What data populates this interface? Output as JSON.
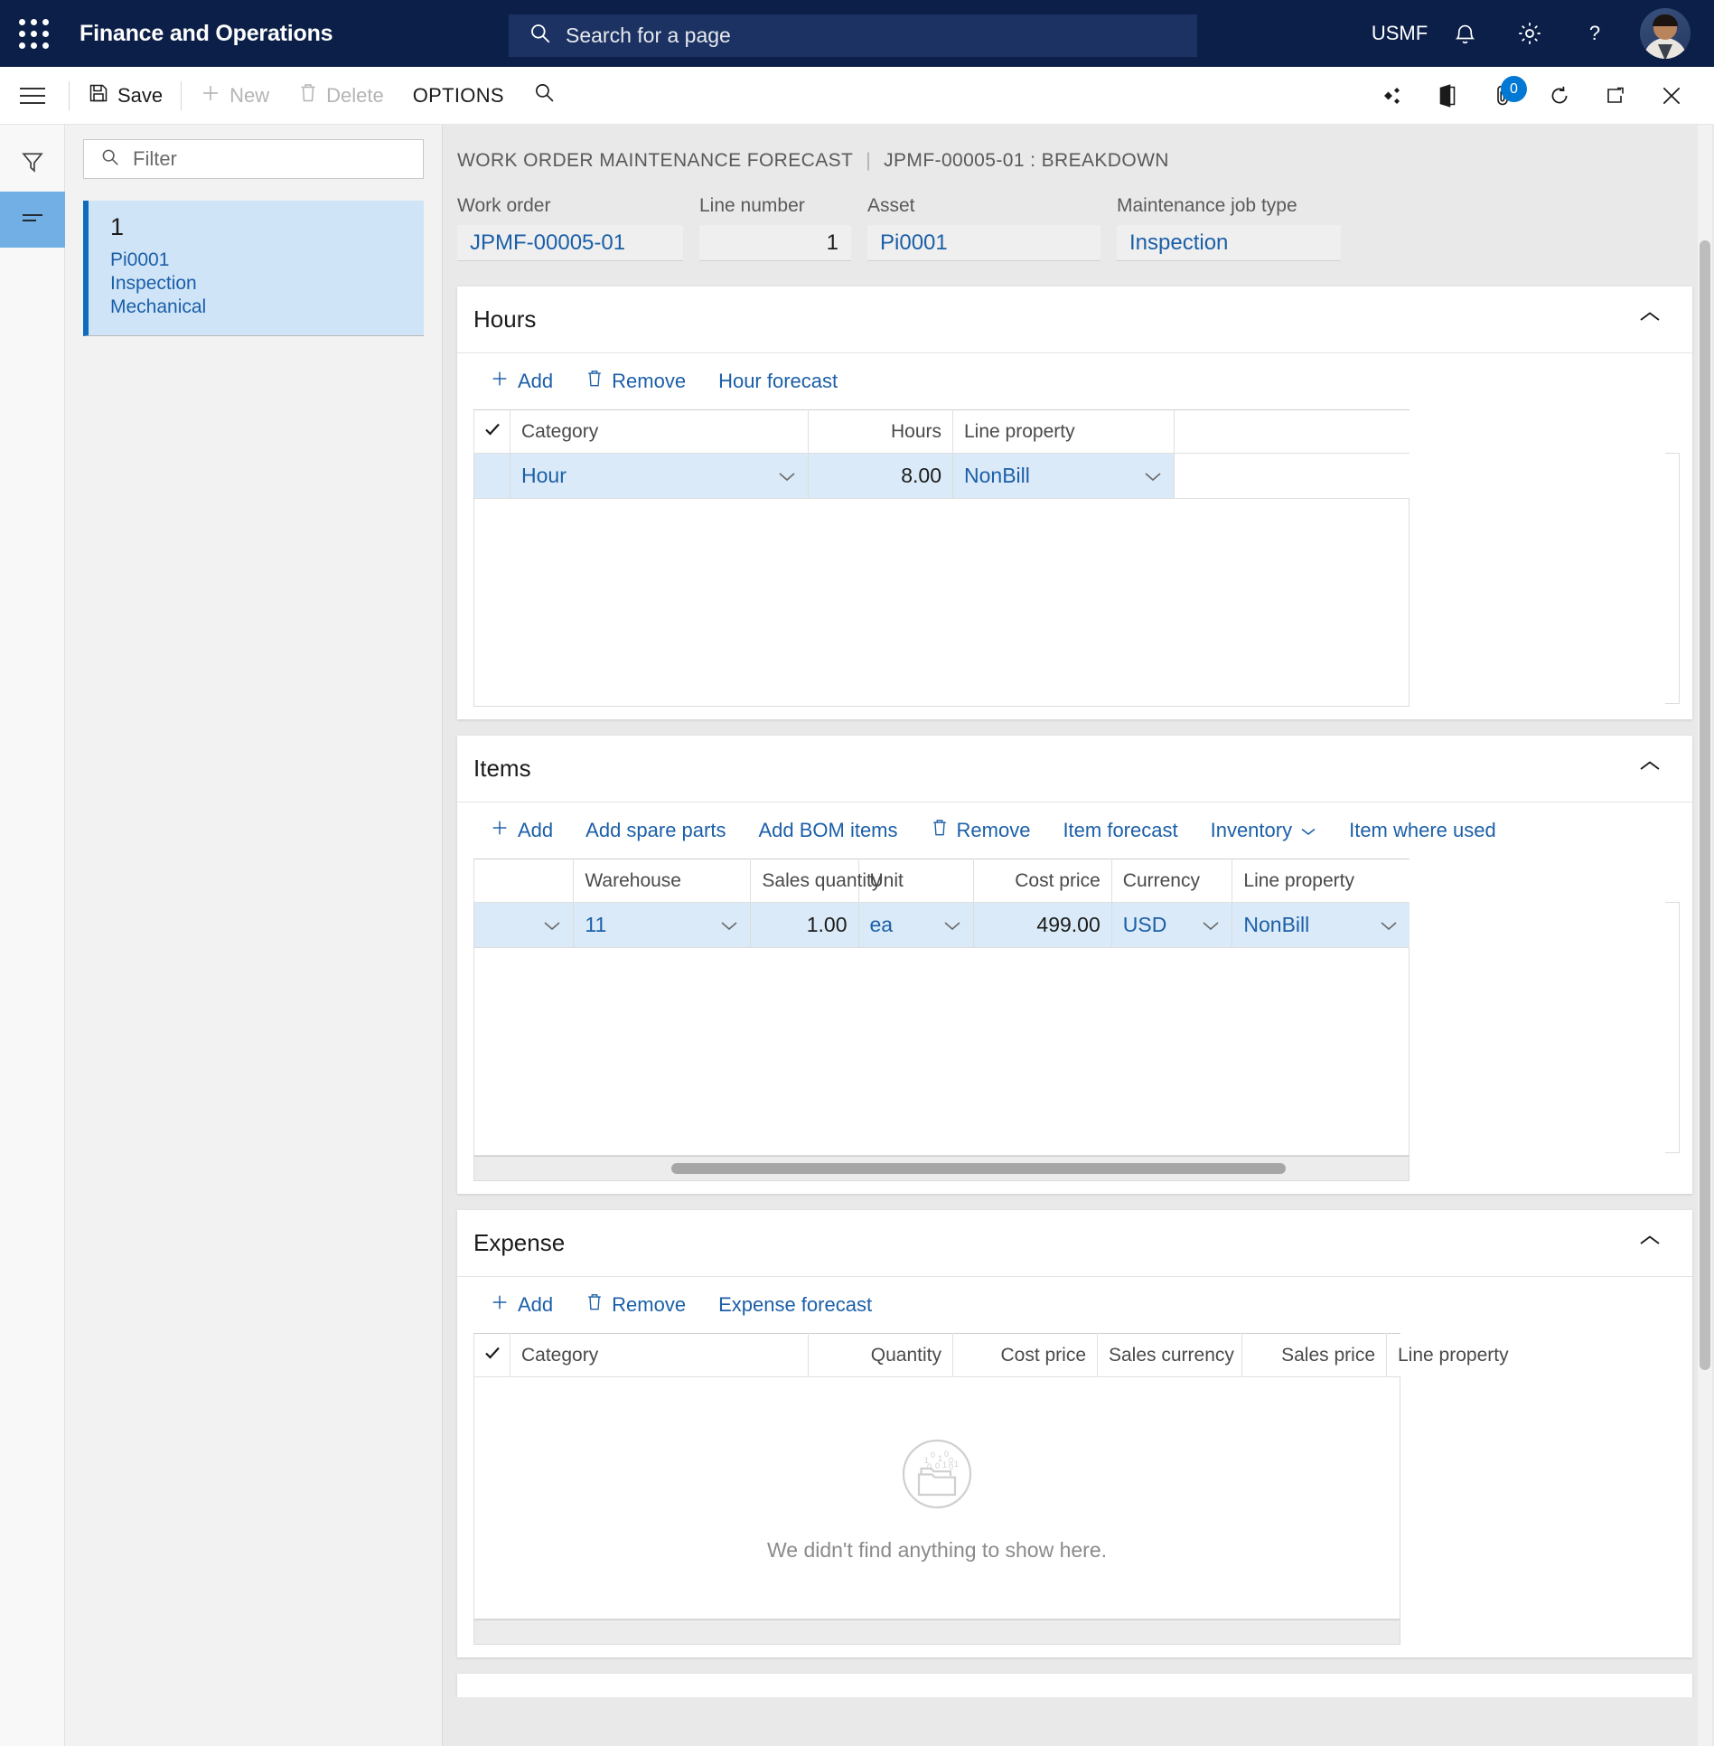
{
  "topnav": {
    "waffle_label": "app-launcher",
    "app_title": "Finance and Operations",
    "search_placeholder": "Search for a page",
    "company": "USMF",
    "icons": [
      "notifications-bell-icon",
      "settings-gear-icon",
      "help-question-icon",
      "user-avatar"
    ]
  },
  "commandbar": {
    "save_label": "Save",
    "new_label": "New",
    "delete_label": "Delete",
    "options_label": "OPTIONS",
    "search_icon": "search-icon",
    "right_icons": [
      "flow-icon",
      "office-icon",
      "attachments-icon",
      "refresh-icon",
      "popout-icon",
      "close-icon"
    ],
    "attachment_count": "0"
  },
  "listpane": {
    "filter_placeholder": "Filter",
    "rail": [
      "filter-icon",
      "list-icon"
    ],
    "cards": [
      {
        "title": "1",
        "lines": [
          "Pi0001",
          "Inspection",
          "Mechanical"
        ]
      }
    ]
  },
  "breadcrumb": {
    "page": "WORK ORDER MAINTENANCE FORECAST",
    "separator": "|",
    "record": "JPMF-00005-01 : BREAKDOWN"
  },
  "header_fields": [
    {
      "label": "Work order",
      "value": "JPMF-00005-01",
      "type": "link"
    },
    {
      "label": "Line number",
      "value": "1",
      "type": "number"
    },
    {
      "label": "Asset",
      "value": "Pi0001",
      "type": "link"
    },
    {
      "label": "Maintenance job type",
      "value": "Inspection",
      "type": "link"
    }
  ],
  "sections": {
    "hours": {
      "title": "Hours",
      "collapse_icon": "chevron-up-icon",
      "toolbar": [
        {
          "label": "Add",
          "icon": "plus-icon"
        },
        {
          "label": "Remove",
          "icon": "trash-icon"
        },
        {
          "label": "Hour forecast",
          "icon": ""
        }
      ],
      "columns": [
        "Category",
        "Hours",
        "Line property"
      ],
      "rows": [
        {
          "category": "Hour",
          "hours": "8.00",
          "line_property": "NonBill"
        }
      ]
    },
    "items": {
      "title": "Items",
      "collapse_icon": "chevron-up-icon",
      "toolbar": [
        {
          "label": "Add",
          "icon": "plus-icon"
        },
        {
          "label": "Add spare parts",
          "icon": ""
        },
        {
          "label": "Add BOM items",
          "icon": ""
        },
        {
          "label": "Remove",
          "icon": "trash-icon"
        },
        {
          "label": "Item forecast",
          "icon": ""
        },
        {
          "label": "Inventory",
          "icon": "chevron-down-icon"
        },
        {
          "label": "Item where used",
          "icon": ""
        }
      ],
      "columns": [
        "",
        "Warehouse",
        "Sales quantity",
        "Unit",
        "Cost price",
        "Currency",
        "Line property"
      ],
      "rows": [
        {
          "first": "",
          "warehouse": "11",
          "sales_quantity": "1.00",
          "unit": "ea",
          "cost_price": "499.00",
          "currency": "USD",
          "line_property": "NonBill"
        }
      ]
    },
    "expense": {
      "title": "Expense",
      "collapse_icon": "chevron-up-icon",
      "toolbar": [
        {
          "label": "Add",
          "icon": "plus-icon"
        },
        {
          "label": "Remove",
          "icon": "trash-icon"
        },
        {
          "label": "Expense forecast",
          "icon": ""
        }
      ],
      "columns": [
        "Category",
        "Quantity",
        "Cost price",
        "Sales currency",
        "Sales price",
        "Line property"
      ],
      "rows": [],
      "empty_message": "We didn't find anything to show here.",
      "empty_icon": "no-data-folder-icon"
    }
  },
  "colors": {
    "nav_bg": "#0b1f48",
    "accent_link": "#1b5fa8",
    "selected_row": "#dbeaf8",
    "rail_active": "#71afe5",
    "badge": "#0078d4"
  }
}
